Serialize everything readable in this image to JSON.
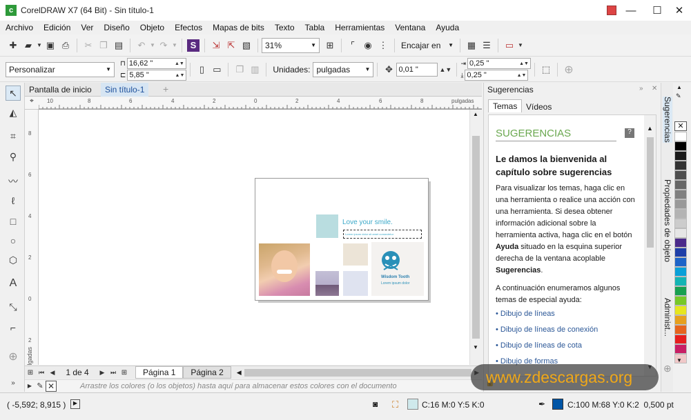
{
  "window": {
    "title": "CorelDRAW X7 (64 Bit) - Sin título-1",
    "app_icon_letter": "c"
  },
  "menu": [
    "Archivo",
    "Edición",
    "Ver",
    "Diseño",
    "Objeto",
    "Efectos",
    "Mapas de bits",
    "Texto",
    "Tabla",
    "Herramientas",
    "Ventana",
    "Ayuda"
  ],
  "standard_toolbar": {
    "zoom": "31%",
    "snap_label": "Encajar en"
  },
  "property_bar": {
    "preset": "Personalizar",
    "width": "16,62 \"",
    "height": "5,85 \"",
    "units_label": "Unidades:",
    "units": "pulgadas",
    "nudge": "0,01 \"",
    "dup_x": "0,25 \"",
    "dup_y": "0,25 \""
  },
  "doc_tabs": [
    "Pantalla de inicio",
    "Sin título-1"
  ],
  "ruler": {
    "h_ticks": [
      "10",
      "8",
      "6",
      "4",
      "2",
      "0",
      "2",
      "4",
      "6",
      "8"
    ],
    "h_units": "pulgadas",
    "v_ticks": [
      "8",
      "6",
      "4",
      "2",
      "0",
      "2"
    ],
    "v_units": "pulgadas"
  },
  "canvas_doc": {
    "headline": "Love your smile.",
    "subline": "Lorem ipsum dolor sit amet consectetur",
    "brand": "Wisdom Tooth",
    "brand_sub": "Lorem ipsum dolor"
  },
  "page_nav": {
    "counter": "1 de 4",
    "pages": [
      "Página 1",
      "Página 2"
    ]
  },
  "color_hint": "Arrastre los colores (o los objetos) hasta aquí para almacenar estos colores con el documento",
  "dock": {
    "panel_title": "Sugerencias",
    "tabs": [
      "Temas",
      "Vídeos"
    ],
    "heading": "SUGERENCIAS",
    "welcome": "Le damos la bienvenida al capítulo sobre sugerencias",
    "para1_a": "Para visualizar los temas, haga clic en una herramienta o realice una acción con una herramienta. Si desea obtener información adicional sobre la herramienta activa, haga clic en el botón ",
    "para1_b": "Ayuda",
    "para1_c": " situado en la esquina superior derecha de la ventana acoplable ",
    "para1_d": "Sugerencias",
    "para1_e": ".",
    "para2": "A continuación enumeramos algunos temas de especial ayuda:",
    "links": [
      "Dibujo de líneas",
      "Dibujo de líneas de conexión",
      "Dibujo de líneas de cota",
      "Dibujo de formas"
    ]
  },
  "dock_side_tabs": [
    "Sugerencias",
    "Propiedades de objeto",
    "Administ..."
  ],
  "palette_colors": [
    "#ffffff",
    "#000000",
    "#1a1a1a",
    "#333333",
    "#4d4d4d",
    "#666666",
    "#808080",
    "#999999",
    "#b3b3b3",
    "#cccccc",
    "#e6e6e6",
    "#4b2a8a",
    "#1f3fa8",
    "#1e64c8",
    "#0aa0d8",
    "#14b4b4",
    "#18a050",
    "#78c828",
    "#e6e61e",
    "#e6a01e",
    "#e6641e",
    "#e61e1e",
    "#c81e64",
    "#f0c8c8"
  ],
  "status": {
    "coords": "( -5,592; 8,915 )",
    "fill": "C:16 M:0 Y:5 K:0",
    "fill_color": "#cfe9ec",
    "outline": "C:100 M:68 Y:0 K:2  0,500 pt",
    "outline_color": "#0055a6"
  },
  "watermark": "www.zdescargas.org"
}
